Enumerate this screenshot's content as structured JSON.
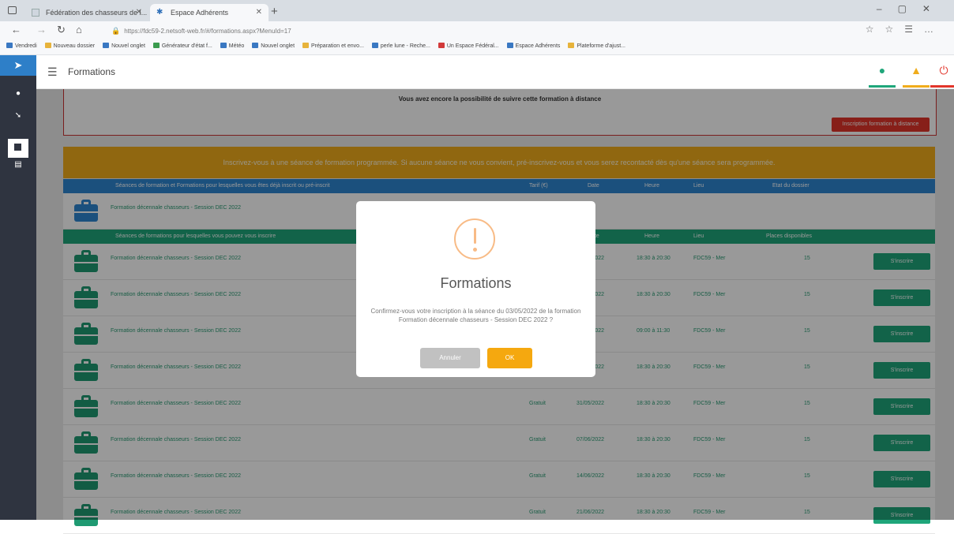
{
  "browser": {
    "tabs": [
      {
        "label": "Fédération des chasseurs de l...",
        "active": false
      },
      {
        "label": "Espace Adhérents",
        "active": true
      }
    ],
    "url": "https://fdc59-2.netsoft-web.fr/#/formations.aspx?MenuId=17",
    "bookmarks": [
      {
        "label": "Vendredi"
      },
      {
        "label": "Nouveau dossier"
      },
      {
        "label": "Nouvel onglet"
      },
      {
        "label": "Générateur d'état f..."
      },
      {
        "label": "Météo"
      },
      {
        "label": "Nouvel onglet"
      },
      {
        "label": "Préparation et envo..."
      },
      {
        "label": "perle lune - Reche..."
      },
      {
        "label": "Un Espace Fédéral..."
      },
      {
        "label": "Espace Adhérents"
      },
      {
        "label": "Plateforme d'ajust..."
      }
    ]
  },
  "app": {
    "title": "Formations",
    "colors": {
      "blue": "#2e86d1",
      "green": "#1fa67a",
      "orange": "#f0ac1c",
      "red": "#e2352a"
    }
  },
  "content": {
    "top_message": "Vous avez encore la possibilité de suivre cette formation à distance",
    "distance_button": "Inscription formation à distance",
    "warning_band": "Inscrivez-vous à une séance de formation programmée. Si aucune séance ne vous convient, pré-inscrivez-vous et vous serez recontacté dès qu'une séance sera programmée.",
    "registered_header": {
      "c1": "Séances de formation et Formations pour lesquelles vous êtes déjà inscrit ou pré-inscrit",
      "c2": "Tarif (€)",
      "c3": "Date",
      "c4": "Heure",
      "c5": "Lieu",
      "c6": "Etat du dossier"
    },
    "registered_rows": [
      {
        "title": "Formation décennale chasseurs - Session DEC 2022"
      }
    ],
    "sessions_header": {
      "c1": "Séances de formations pour lesquelles vous pouvez vous inscrire",
      "c3": "Date",
      "c4": "Heure",
      "c5": "Lieu",
      "c6": "Places disponibles"
    },
    "sessions": [
      {
        "title": "Formation décennale chasseurs - Session DEC 2022",
        "price": "",
        "date": "03/05/2022",
        "time": "18:30 à 20:30",
        "place": "FDC59 - Mer",
        "seats": "15",
        "button": "S'inscrire"
      },
      {
        "title": "Formation décennale chasseurs - Session DEC 2022",
        "price": "",
        "date": "10/05/2022",
        "time": "18:30 à 20:30",
        "place": "FDC59 - Mer",
        "seats": "15",
        "button": "S'inscrire"
      },
      {
        "title": "Formation décennale chasseurs - Session DEC 2022",
        "price": "",
        "date": "17/05/2022",
        "time": "09:00 à 11:30",
        "place": "FDC59 - Mer",
        "seats": "15",
        "button": "S'inscrire"
      },
      {
        "title": "Formation décennale chasseurs - Session DEC 2022",
        "price": "",
        "date": "24/05/2022",
        "time": "18:30 à 20:30",
        "place": "FDC59 - Mer",
        "seats": "15",
        "button": "S'inscrire"
      },
      {
        "title": "Formation décennale chasseurs - Session DEC 2022",
        "price": "Gratuit",
        "date": "31/05/2022",
        "time": "18:30 à 20:30",
        "place": "FDC59 - Mer",
        "seats": "15",
        "button": "S'inscrire"
      },
      {
        "title": "Formation décennale chasseurs - Session DEC 2022",
        "price": "Gratuit",
        "date": "07/06/2022",
        "time": "18:30 à 20:30",
        "place": "FDC59 - Mer",
        "seats": "15",
        "button": "S'inscrire"
      },
      {
        "title": "Formation décennale chasseurs - Session DEC 2022",
        "price": "Gratuit",
        "date": "14/06/2022",
        "time": "18:30 à 20:30",
        "place": "FDC59 - Mer",
        "seats": "15",
        "button": "S'inscrire"
      },
      {
        "title": "Formation décennale chasseurs - Session DEC 2022",
        "price": "Gratuit",
        "date": "21/06/2022",
        "time": "18:30 à 20:30",
        "place": "FDC59 - Mer",
        "seats": "15",
        "button": "S'inscrire"
      }
    ]
  },
  "modal": {
    "title": "Formations",
    "text": "Confirmez-vous votre inscription à la séance du 03/05/2022 de la formation Formation décennale chasseurs - Session DEC 2022 ?",
    "cancel_label": "Annuler",
    "ok_label": "OK"
  }
}
